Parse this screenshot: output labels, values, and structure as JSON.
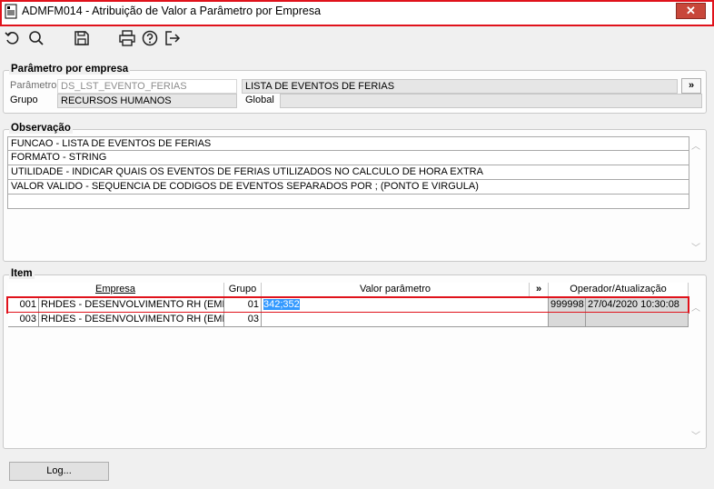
{
  "window": {
    "title": "ADMFM014 - Atribuição de Valor a Parâmetro por Empresa",
    "close_label": "✕"
  },
  "toolbar": {
    "icons": [
      "undo-icon",
      "search-icon",
      "save-icon",
      "print-icon",
      "help-icon",
      "exit-icon"
    ]
  },
  "parametro_por_empresa": {
    "legend": "Parâmetro por empresa",
    "parametro_label": "Parâmetro",
    "parametro_code": "DS_LST_EVENTO_FERIAS",
    "parametro_desc": "LISTA DE EVENTOS DE FERIAS",
    "expand_label": "»",
    "grupo_label": "Grupo",
    "grupo_value": "RECURSOS HUMANOS",
    "global_label": "Global",
    "global_value": ""
  },
  "observacao": {
    "legend": "Observação",
    "lines": [
      "FUNCAO - LISTA DE EVENTOS DE FERIAS",
      "FORMATO - STRING",
      "UTILIDADE - INDICAR QUAIS OS EVENTOS DE FERIAS UTILIZADOS NO CALCULO DE HORA EXTRA",
      "VALOR VALIDO - SEQUENCIA DE CODIGOS DE EVENTOS SEPARADOS POR ; (PONTO E VIRGULA)",
      ""
    ]
  },
  "item": {
    "legend": "Item",
    "columns": {
      "empresa": "Empresa",
      "grupo": "Grupo",
      "valor": "Valor parâmetro",
      "expand": "»",
      "operador": "Operador/Atualização"
    },
    "rows": [
      {
        "codigo": "001",
        "empresa": "RHDES - DESENVOLVIMENTO RH (EMPRE",
        "grupo": "01",
        "valor": "342;352",
        "operador": "999998",
        "atualizacao": "27/04/2020 10:30:08"
      },
      {
        "codigo": "003",
        "empresa": "RHDES - DESENVOLVIMENTO RH (EMPRE",
        "grupo": "03",
        "valor": "",
        "operador": "",
        "atualizacao": ""
      }
    ]
  },
  "footer": {
    "log_button": "Log..."
  },
  "colors": {
    "highlight": "#e0121b",
    "selection": "#3399ff"
  }
}
